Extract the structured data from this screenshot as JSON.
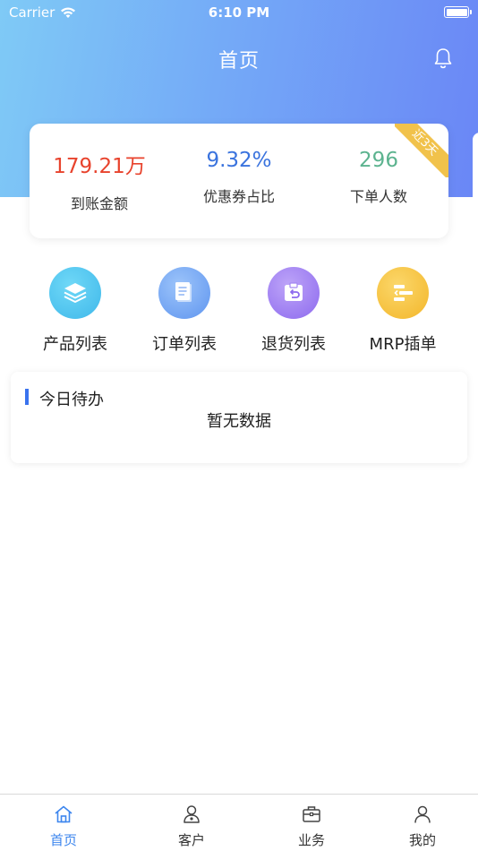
{
  "status_bar": {
    "carrier": "Carrier",
    "time": "6:10 PM"
  },
  "nav": {
    "title": "首页"
  },
  "stats": {
    "badge": "近3天",
    "items": [
      {
        "value": "179.21万",
        "label": "到账金额",
        "color": "#e8432d"
      },
      {
        "value": "9.32%",
        "label": "优惠券占比",
        "color": "#3a73de"
      },
      {
        "value": "296",
        "label": "下单人数",
        "color": "#5cb38f"
      }
    ]
  },
  "actions": [
    {
      "label": "产品列表",
      "icon": "layers-icon",
      "color": "#4cc4ef"
    },
    {
      "label": "订单列表",
      "icon": "document-icon",
      "color": "#6aa0f3"
    },
    {
      "label": "退货列表",
      "icon": "return-box-icon",
      "color": "#9b7cf0"
    },
    {
      "label": "MRP插单",
      "icon": "gantt-icon",
      "color": "#f6c33c"
    }
  ],
  "todo": {
    "title": "今日待办",
    "empty": "暂无数据"
  },
  "tabs": [
    {
      "label": "首页",
      "icon": "home-icon",
      "active": true
    },
    {
      "label": "客户",
      "icon": "customer-icon",
      "active": false
    },
    {
      "label": "业务",
      "icon": "briefcase-icon",
      "active": false
    },
    {
      "label": "我的",
      "icon": "profile-icon",
      "active": false
    }
  ],
  "colors": {
    "accent": "#3d86ee",
    "header_start": "#7fcaf6",
    "header_end": "#6a86f6"
  }
}
